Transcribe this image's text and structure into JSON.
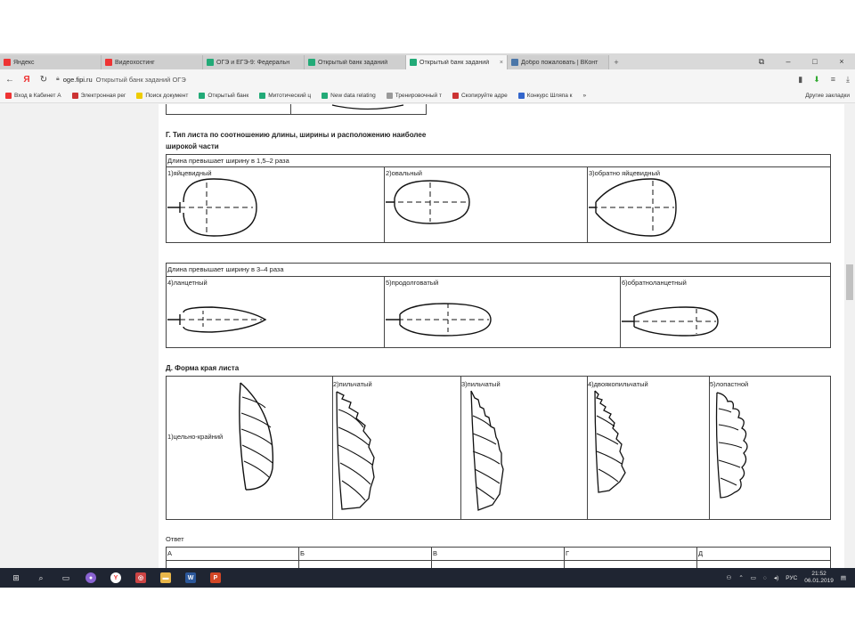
{
  "tabs": [
    {
      "label": "Яндекс",
      "color": "#e33"
    },
    {
      "label": "Видеохостинг",
      "color": "#e33"
    },
    {
      "label": "ОГЭ и ЕГЭ-9: Федеральн",
      "color": "#2a7"
    },
    {
      "label": "Открытый банк заданий",
      "color": "#2a7"
    },
    {
      "label": "Открытый банк заданий",
      "color": "#2a7"
    },
    {
      "label": "Добро пожаловать | ВКонт",
      "color": "#4a76a8"
    }
  ],
  "window_controls": {
    "minimize": "–",
    "maximize": "□",
    "close": "×"
  },
  "address": {
    "domain": "oge.fipi.ru",
    "page_title": "Открытый банк заданий ОГЭ"
  },
  "bookmarks": [
    {
      "label": "Вход в Кабинет А",
      "color": "#e33"
    },
    {
      "label": "Электронная рег",
      "color": "#c33"
    },
    {
      "label": "Поиск документ",
      "color": "#ec0"
    },
    {
      "label": "Открытый банк",
      "color": "#2a7"
    },
    {
      "label": "Митотический ц",
      "color": "#2a7"
    },
    {
      "label": "New data relating",
      "color": "#2a7"
    },
    {
      "label": "Тренировочный т",
      "color": "#999"
    },
    {
      "label": "Скопируйте адре",
      "color": "#c33"
    },
    {
      "label": "Конкурс Шляпа к",
      "color": "#36c"
    }
  ],
  "bookmarks_more": "»",
  "other_bookmarks": "Другие закладки",
  "section_g": {
    "title_line1": "Г. Тип листа по соотношению длины, ширины и расположению наиболее",
    "title_line2": "широкой части",
    "group1": "Длина превышает ширину в 1,5–2 раза",
    "group1_items": [
      "1)яйцевидный",
      "2)овальный",
      "3)обратно яйцевидный"
    ],
    "group2": "Длина превышает ширину в 3–4 раза",
    "group2_items": [
      "4)ланцетный",
      "5)продолговатый",
      "6)обратноланцетный"
    ]
  },
  "section_d": {
    "title": "Д. Форма края листа",
    "items": [
      "1)цельно-крайний",
      "2)пильчатый",
      "3)пильчатый",
      "4)двоякопильчатый",
      "5)лопастной"
    ]
  },
  "answer": {
    "label": "Ответ",
    "columns": [
      "А",
      "Б",
      "В",
      "Г",
      "Д"
    ]
  },
  "tray": {
    "lang": "РУС",
    "time": "21:52",
    "date": "06.01.2019"
  }
}
